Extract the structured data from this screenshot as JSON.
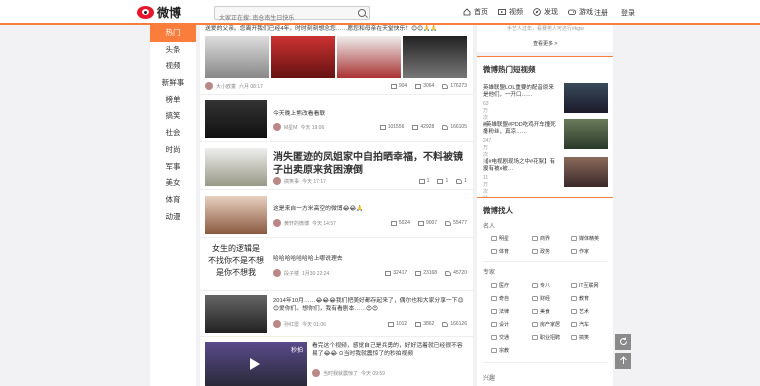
{
  "topbar": {
    "logo_text": "微博",
    "search_placeholder": "大家正在搜: 南仓南生日快乐",
    "nav": [
      {
        "label": "首页",
        "icon": "home-icon"
      },
      {
        "label": "视频",
        "icon": "video-icon"
      },
      {
        "label": "发现",
        "icon": "discover-icon"
      },
      {
        "label": "游戏",
        "icon": "game-icon"
      }
    ],
    "register": "注册",
    "login": "登录"
  },
  "leftnav": [
    "热门",
    "头条",
    "视频",
    "新鲜事",
    "榜单",
    "搞笑",
    "社会",
    "时尚",
    "军事",
    "美女",
    "体育",
    "动漫"
  ],
  "feed": [
    {
      "title": "送爱的父亲。您离开我们已经4年，时时刻刻想念您……愿您和母亲在天堂快乐！😊😊🙏🙏",
      "author": "大小欧童",
      "time": "六月 08:17",
      "shares": "904",
      "comments": "3064",
      "likes": "176273"
    },
    {
      "title": "今天晚上熊改看看联",
      "author": "M星M",
      "time": "今天 19:06",
      "shares": "101556",
      "comments": "42928",
      "likes": "166105"
    },
    {
      "title": "消失匿迹的凤姐家中自拍晒幸福，不料被镜子出卖原来贫困潦倒",
      "author": "搞笑事",
      "time": "今天 17:17",
      "shares": "1",
      "comments": "1",
      "likes": "1"
    },
    {
      "title": "这是来自一方米高空的微博😂😂🙏",
      "author": "黄轩的微博",
      "time": "今天 14:57",
      "shares": "5024",
      "comments": "9007",
      "likes": "55477"
    },
    {
      "title": "哈哈哈哈哈哈哈上哪说理去",
      "image_text": [
        "女生的逻辑是",
        "不找你不是不想",
        "是你不想我"
      ],
      "author": "段子楼",
      "time": "1月30 22:24",
      "shares": "32417",
      "comments": "23168",
      "likes": "45720"
    },
    {
      "title": "2014年10月……😂😂😂我们把美好都存起来了，偶尔也和大家分享一下😊😊爱你们。想你们，我有看剧本……😍😍",
      "author": "孙红雷",
      "time": "今天 01:06",
      "shares": "1012",
      "comments": "3862",
      "likes": "166126"
    },
    {
      "title": "看完这个视频，感觉自己是兵勇的，好好活着就已经很不容易了😂😂 ⊙当时我就震惊了的秒拍视频",
      "author": "当时我就震惊了",
      "time": "今天 09:59",
      "video_label": "秒拍"
    }
  ],
  "sidebar": {
    "top_caption": "手艺人过年，看赛男人可还行#kgw",
    "more_recommend": "查看更多 >",
    "hot_video_title": "微博热门短视频",
    "videos": [
      {
        "title": "英雄联盟LOL重要的配音原来是他们，一开口……",
        "count": "63万次播放"
      },
      {
        "title": "#英雄联盟#PDD吃鸡开车撞死冬粉丝，真凉……",
        "count": "247万次播放"
      },
      {
        "title": "【#电视剧现场之中#花絮】有没有被x被…",
        "count": "11万次播放"
      }
    ],
    "find_people_title": "微博找人",
    "categories": [
      {
        "label": "名人",
        "tags": [
          "明星",
          "商界",
          "媒体精英",
          "体育",
          "政务",
          "作家"
        ]
      },
      {
        "label": "专家",
        "tags": [
          "医疗",
          "专八",
          "IT互联网",
          "奇自",
          "财经",
          "教育",
          "法律",
          "美食",
          "艺术",
          "设计",
          "房产家居",
          "汽车",
          "交通",
          "职业招聘",
          "搞笑",
          "宗教"
        ]
      },
      {
        "label": "兴趣"
      }
    ]
  },
  "colors": {
    "accent": "#fa7d3c",
    "brand_red": "#e6162d"
  }
}
